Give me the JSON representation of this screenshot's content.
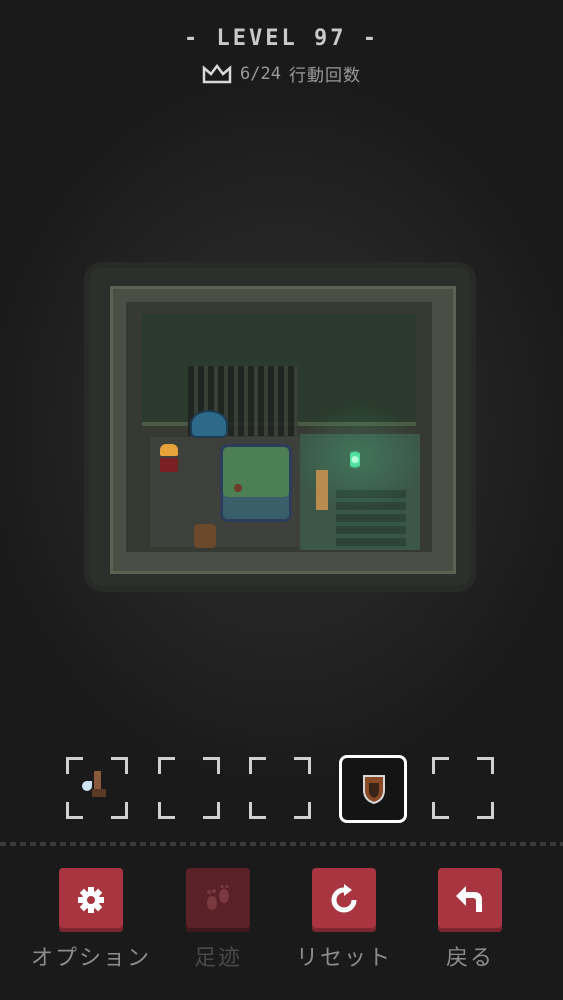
{
  "header": {
    "level_title": "- LEVEL 97 -",
    "moves_count": "6/24",
    "moves_label": "行動回数",
    "crown_icon": "crown-icon"
  },
  "inventory": {
    "slots": [
      {
        "item": "winged-boots-icon",
        "selected": false
      },
      {
        "item": "",
        "selected": false
      },
      {
        "item": "",
        "selected": false
      },
      {
        "item": "shield-icon",
        "selected": true
      },
      {
        "item": "",
        "selected": false
      }
    ]
  },
  "controls": {
    "options_label": "オプション",
    "footprints_label": "足迹",
    "reset_label": "リセット",
    "back_label": "戻る"
  },
  "colors": {
    "button": "#a83540",
    "button_disabled": "#5a2228",
    "torch": "#4fe0a0"
  }
}
